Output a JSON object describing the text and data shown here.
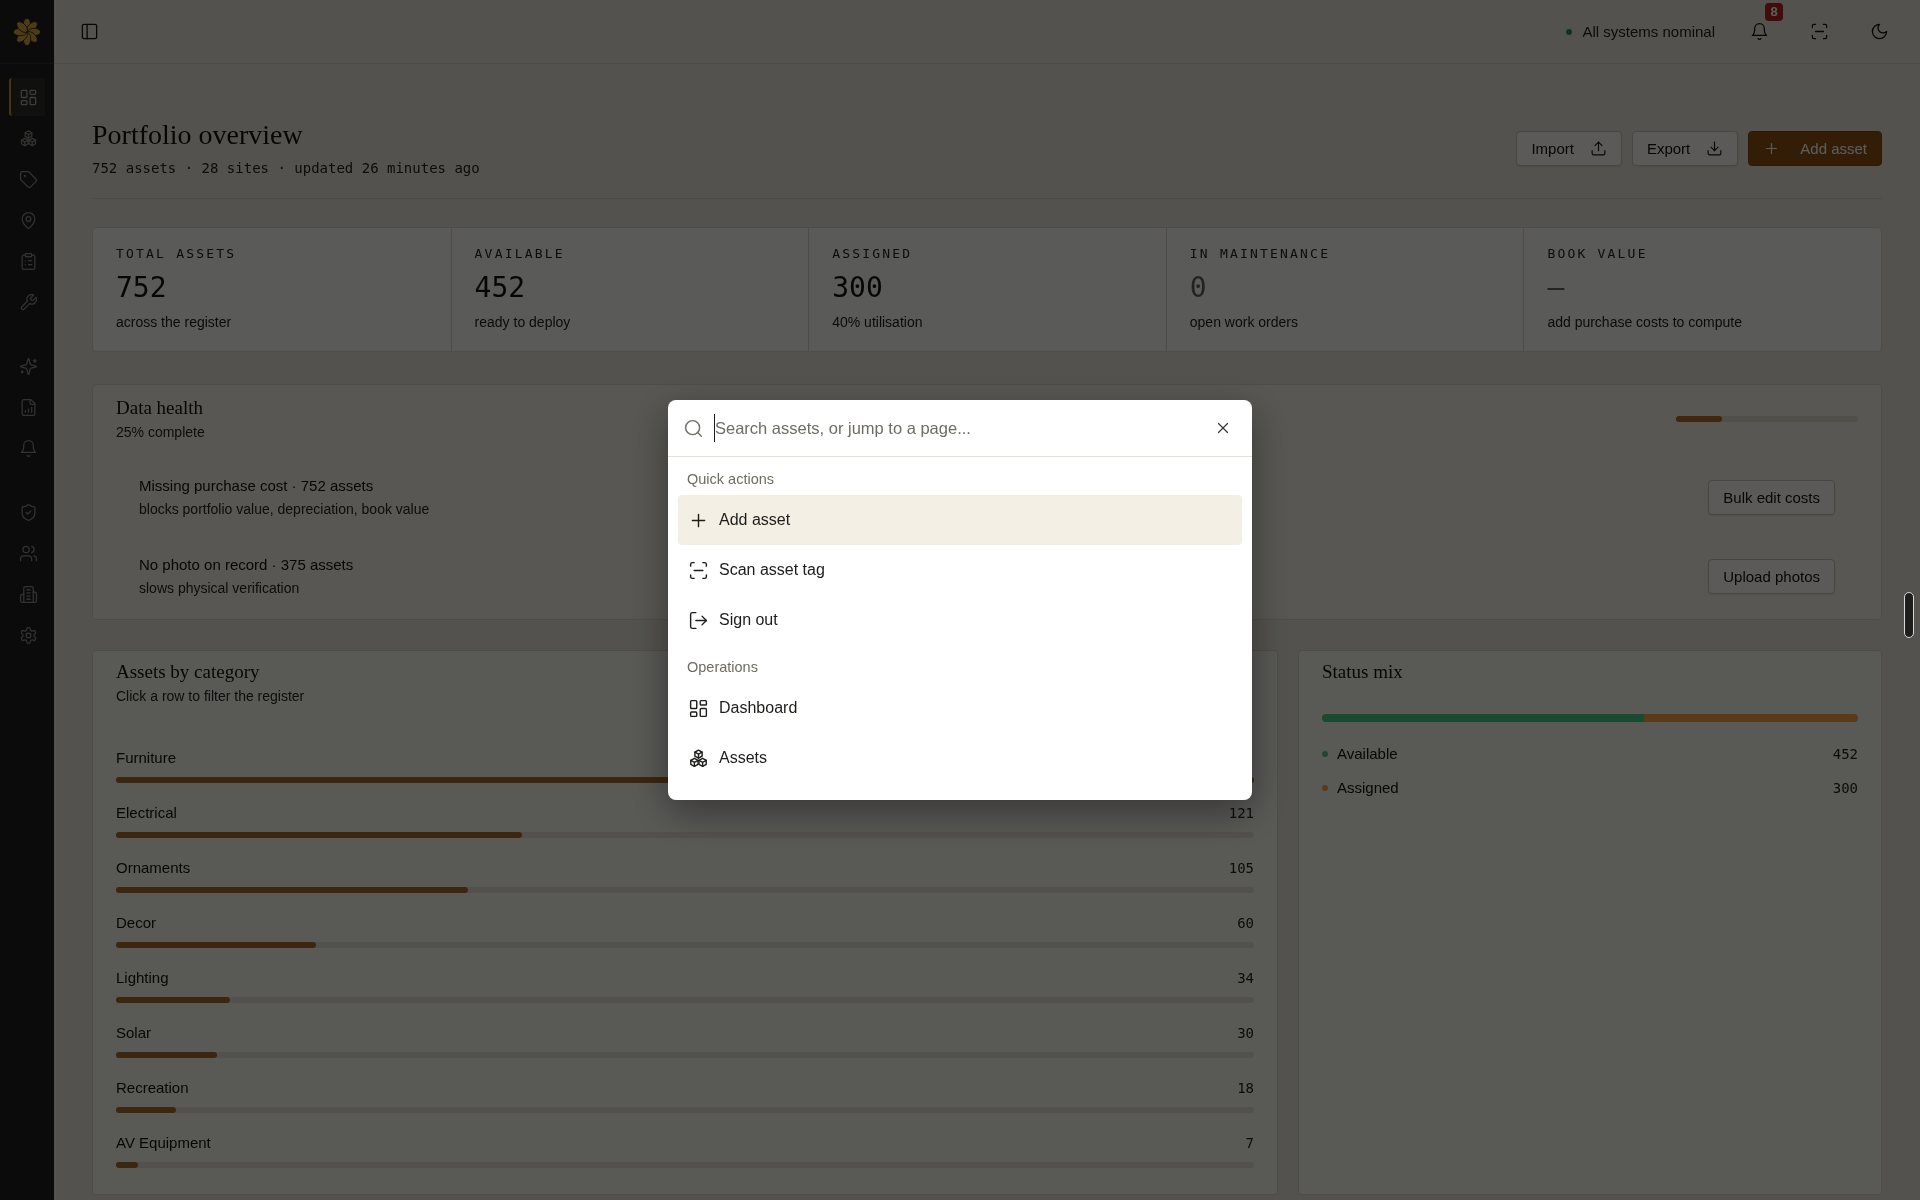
{
  "sidebar": {
    "groups": [
      [
        {
          "selected": true
        },
        {
          "selected": false
        },
        {
          "selected": false
        },
        {
          "selected": false
        },
        {
          "selected": false
        },
        {
          "selected": false
        }
      ],
      [
        {
          "selected": false
        },
        {
          "selected": false
        },
        {
          "selected": false
        }
      ],
      [
        {
          "selected": false
        },
        {
          "selected": false
        },
        {
          "selected": false
        },
        {
          "selected": false
        }
      ]
    ]
  },
  "topbar": {
    "status": "All systems nominal",
    "notifications": "8"
  },
  "header": {
    "title": "Portfolio overview",
    "subtitle": "752 assets · 28 sites · updated 26 minutes ago",
    "buttons": [
      {
        "label": "Import",
        "kind": "outline"
      },
      {
        "label": "Export",
        "kind": "outline"
      },
      {
        "label": "Add asset",
        "kind": "primary"
      }
    ]
  },
  "stats": [
    {
      "label": "TOTAL ASSETS",
      "value": "752",
      "note": "across the register",
      "muted": false
    },
    {
      "label": "AVAILABLE",
      "value": "452",
      "note": "ready to deploy",
      "muted": false
    },
    {
      "label": "ASSIGNED",
      "value": "300",
      "note": "40% utilisation",
      "muted": false
    },
    {
      "label": "IN MAINTENANCE",
      "value": "0",
      "note": "open work orders",
      "muted": true
    },
    {
      "label": "BOOK VALUE",
      "value": "—",
      "note": "add purchase costs to compute",
      "muted": true
    }
  ],
  "data_health": {
    "title": "Data health",
    "subtitle": "25% complete",
    "level": 0.25,
    "issues": [
      {
        "title": "Missing purchase cost · 752 assets",
        "detail": "blocks portfolio value, depreciation, book value",
        "action": "Bulk edit costs"
      },
      {
        "title": "No photo on record · 375 assets",
        "detail": "slows physical verification",
        "action": "Upload photos"
      }
    ]
  },
  "categories": {
    "title": "Assets by category",
    "subtitle": "Click a row to filter the register",
    "rows": [
      {
        "label": "Furniture",
        "level": 1.0
      },
      {
        "label": "Electrical",
        "count": "121",
        "level": 0.357
      },
      {
        "label": "Ornaments",
        "count": "105",
        "level": 0.309
      },
      {
        "label": "Decor",
        "count": "60",
        "level": 0.176
      },
      {
        "label": "Lighting",
        "count": "34",
        "level": 0.1
      },
      {
        "label": "Solar",
        "count": "30",
        "level": 0.089
      },
      {
        "label": "Recreation",
        "count": "18",
        "level": 0.053
      },
      {
        "label": "AV Equipment",
        "count": "7",
        "level": 0.019
      }
    ]
  },
  "status_mix": {
    "title": "Status mix",
    "segments": [
      {
        "label": "Available",
        "count": "452",
        "color": "#1a4a30"
      },
      {
        "label": "Assigned",
        "count": "300",
        "color": "#5a3a18"
      }
    ]
  },
  "command_palette": {
    "search": {
      "placeholder": "Search assets, or jump to a page..."
    },
    "sections": [
      {
        "title": "Quick actions",
        "items": [
          {
            "label": "Add asset",
            "selected": true
          },
          {
            "label": "Scan asset tag",
            "selected": false
          },
          {
            "label": "Sign out",
            "selected": false
          }
        ]
      },
      {
        "title": "Operations",
        "items": [
          {
            "label": "Dashboard",
            "selected": false
          },
          {
            "label": "Assets",
            "selected": false
          }
        ]
      }
    ]
  }
}
